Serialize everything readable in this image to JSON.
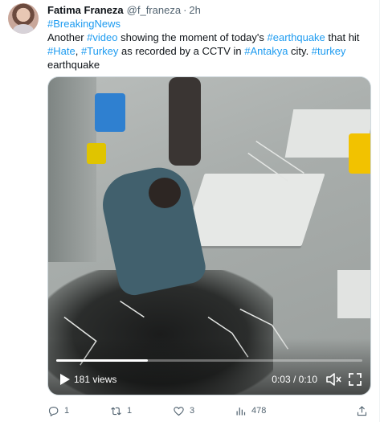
{
  "tweet": {
    "author_name": "Fatima Franeza",
    "handle": "@f_franeza",
    "separator": "·",
    "time": "2h",
    "text_lines": [
      [
        {
          "t": "#BreakingNews",
          "tag": true
        }
      ],
      [
        {
          "t": "Another ",
          "tag": false
        },
        {
          "t": "#video",
          "tag": true
        },
        {
          "t": " showing the moment of today's ",
          "tag": false
        },
        {
          "t": "#earthquake",
          "tag": true
        },
        {
          "t": " that hit",
          "tag": false
        }
      ],
      [
        {
          "t": "#Hate",
          "tag": true
        },
        {
          "t": ", ",
          "tag": false
        },
        {
          "t": "#Turkey",
          "tag": true
        },
        {
          "t": " as recorded by a CCTV in ",
          "tag": false
        },
        {
          "t": "#Antakya",
          "tag": true
        },
        {
          "t": " city. ",
          "tag": false
        },
        {
          "t": "#turkey",
          "tag": true
        }
      ],
      [
        {
          "t": "earthquake",
          "tag": false
        }
      ]
    ]
  },
  "video": {
    "views_label": "181 views",
    "time_label": "0:03 / 0:10",
    "progress": 0.3
  },
  "actions": {
    "reply_count": "1",
    "retweet_count": "1",
    "like_count": "3",
    "views_count": "478"
  },
  "colors": {
    "link": "#1d9bf0",
    "muted": "#536471",
    "text": "#0f1419"
  },
  "icons": {
    "reply": "reply-icon",
    "retweet": "retweet-icon",
    "like": "heart-icon",
    "views": "analytics-icon",
    "share": "share-icon",
    "play": "play-icon",
    "volume": "volume-icon",
    "fullscreen": "fullscreen-icon"
  }
}
